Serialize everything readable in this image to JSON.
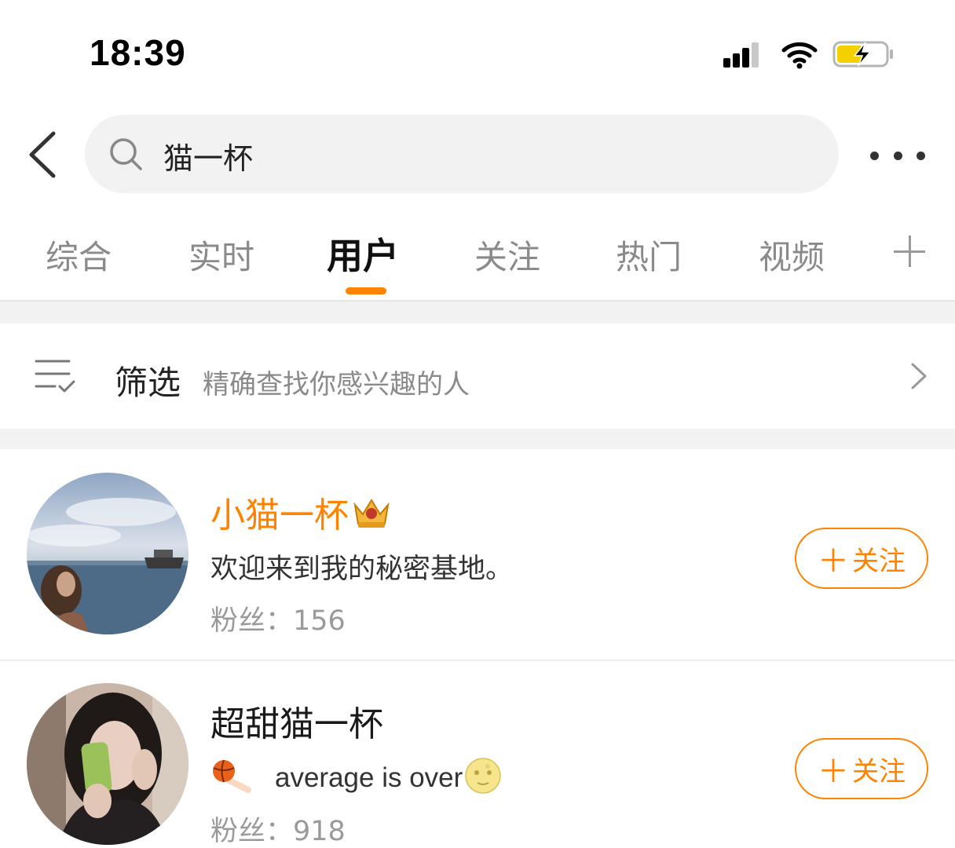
{
  "status_bar": {
    "time": "18:39"
  },
  "search": {
    "query": "猫一杯"
  },
  "tabs": [
    {
      "label": "综合"
    },
    {
      "label": "实时"
    },
    {
      "label": "用户"
    },
    {
      "label": "关注"
    },
    {
      "label": "热门"
    },
    {
      "label": "视频"
    }
  ],
  "active_tab": "用户",
  "filter": {
    "label": "筛选",
    "description": "精确查找你感兴趣的人"
  },
  "users": [
    {
      "name": "小猫一杯",
      "name_color": "#ff8200",
      "badge": "crown-icon",
      "bio": "欢迎来到我的秘密基地。",
      "fans_label": "粉丝：",
      "fans_count": "156",
      "follow_label": "关注"
    },
    {
      "name": "超甜猫一杯",
      "name_color": "#1a1a1a",
      "bio_icon": "basketball-icon",
      "bio": "average is over",
      "bio_emoji": "moon-face-icon",
      "fans_label": "粉丝：",
      "fans_count": "918",
      "follow_label": "关注"
    }
  ],
  "colors": {
    "accent": "#ff8200",
    "gap_background": "#f2f2f2",
    "search_background": "#f2f2f2"
  }
}
